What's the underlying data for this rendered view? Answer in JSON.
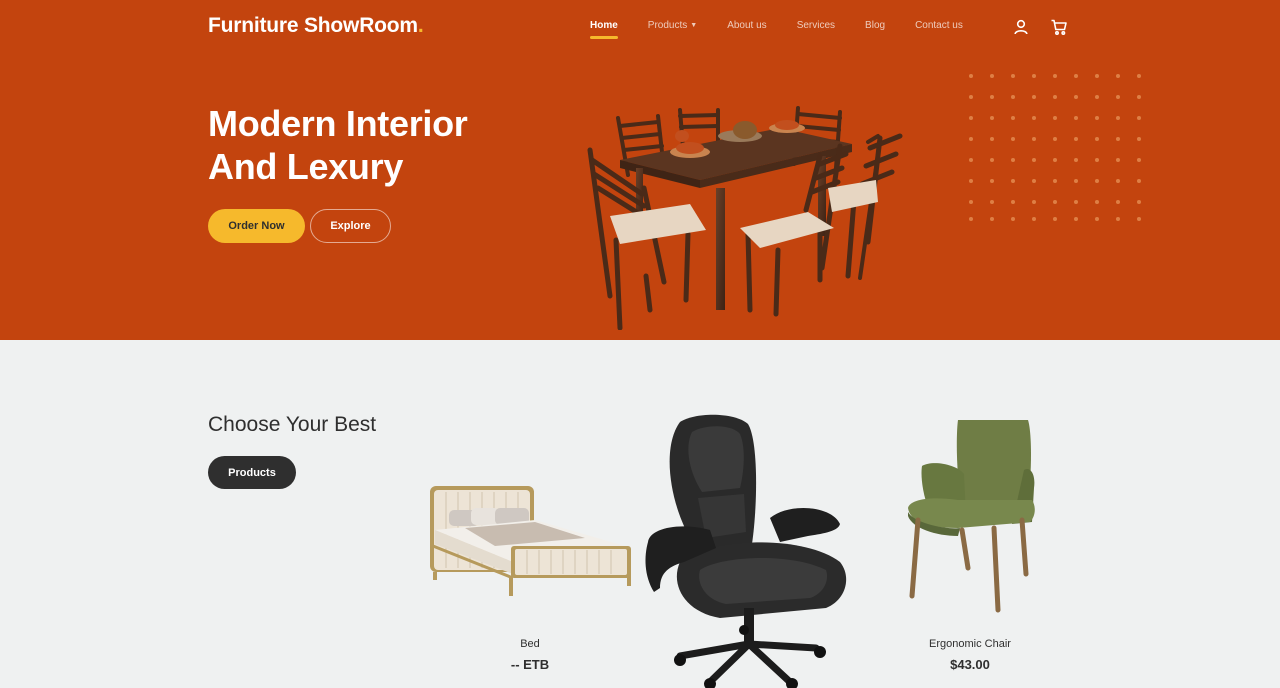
{
  "brand": {
    "name": "Furniture ShowRoom",
    "dot": ".",
    "accent": "#f6b92c",
    "hero_bg": "#c3440e"
  },
  "nav": {
    "items": [
      {
        "label": "Home",
        "active": true
      },
      {
        "label": "Products",
        "has_dropdown": true
      },
      {
        "label": "About us"
      },
      {
        "label": "Services"
      },
      {
        "label": "Blog"
      },
      {
        "label": "Contact us"
      }
    ],
    "icons": [
      "user-icon",
      "cart-icon"
    ]
  },
  "hero": {
    "title_line1": "Modern Interior",
    "title_line2": "And Lexury",
    "primary_button": "Order Now",
    "secondary_button": "Explore",
    "image": "dining-table-set-image"
  },
  "products_section": {
    "title": "Choose Your Best",
    "button": "Products",
    "items": [
      {
        "name": "Bed",
        "price": "-- ETB",
        "image": "bed-image"
      },
      {
        "name": "",
        "price": "",
        "image": "office-chair-image"
      },
      {
        "name": "Ergonomic Chair",
        "price": "$43.00",
        "image": "green-chair-image"
      }
    ]
  }
}
